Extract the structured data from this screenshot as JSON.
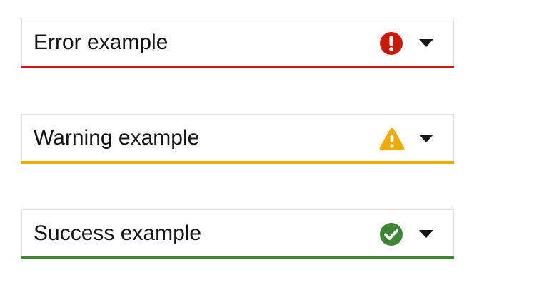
{
  "selects": [
    {
      "value": "Error example",
      "status": "error",
      "status_icon": "exclamation-circle-icon",
      "color": "#c9190b"
    },
    {
      "value": "Warning example",
      "status": "warning",
      "status_icon": "exclamation-triangle-icon",
      "color": "#f0ab00"
    },
    {
      "value": "Success example",
      "status": "success",
      "status_icon": "check-circle-icon",
      "color": "#3e8635"
    }
  ],
  "toggle_icon": "caret-down-icon",
  "text_color": "#151515"
}
